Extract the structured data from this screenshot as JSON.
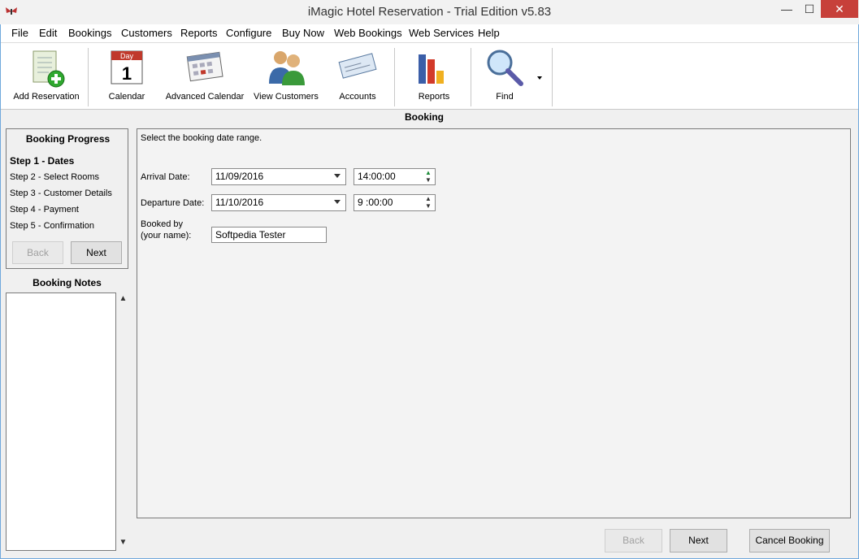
{
  "window": {
    "title": "iMagic Hotel Reservation - Trial Edition v5.83",
    "minimize": "—",
    "maximize": "☐",
    "close": "✕"
  },
  "menu": [
    "File",
    "Edit",
    "Bookings",
    "Customers",
    "Reports",
    "Configure",
    "Buy Now",
    "Web Bookings",
    "Web Services",
    "Help"
  ],
  "toolbar": {
    "add_reservation": "Add Reservation",
    "calendar": "Calendar",
    "calendar_day": "Day",
    "calendar_num": "1",
    "advanced_calendar": "Advanced Calendar",
    "view_customers": "View Customers",
    "accounts": "Accounts",
    "reports": "Reports",
    "find": "Find"
  },
  "section_heading": "Booking",
  "progress": {
    "title": "Booking Progress",
    "steps": [
      "Step 1 - Dates",
      "Step 2 - Select Rooms",
      "Step 3 - Customer Details",
      "Step 4 - Payment",
      "Step 5 - Confirmation"
    ],
    "back": "Back",
    "next": "Next"
  },
  "notes": {
    "title": "Booking Notes",
    "value": ""
  },
  "form": {
    "instruction": "Select the booking date range.",
    "arrival_label": "Arrival Date:",
    "arrival_date": "11/09/2016",
    "arrival_time": "14:00:00",
    "departure_label": "Departure Date:",
    "departure_date": "11/10/2016",
    "departure_time": "9 :00:00",
    "booked_by_label_1": "Booked by",
    "booked_by_label_2": "(your name):",
    "booked_by_value": "Softpedia Tester"
  },
  "footer": {
    "back": "Back",
    "next": "Next",
    "cancel": "Cancel Booking"
  },
  "colors": {
    "close_button": "#c7403a",
    "frame_border": "#6fa8dc"
  }
}
